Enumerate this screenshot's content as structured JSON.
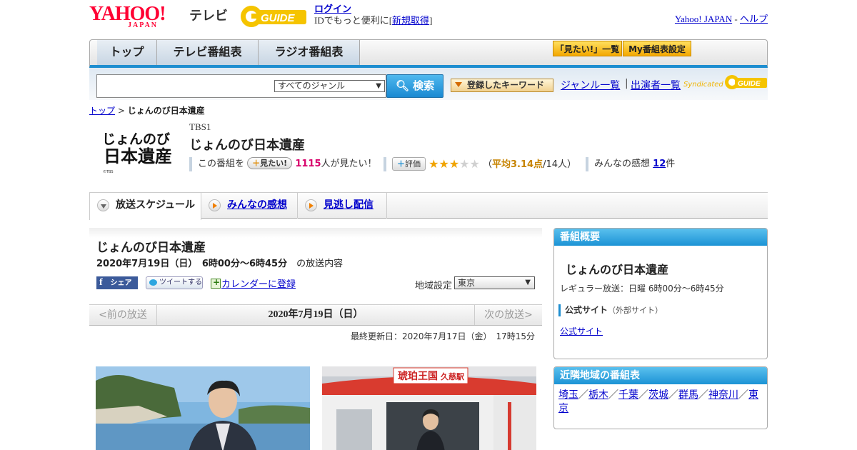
{
  "header": {
    "logo_text": "YAHOO!",
    "logo_sub": "JAPAN",
    "tv_label": "テレビ",
    "gguide_label": "G-GUIDE",
    "login": "ログイン",
    "login_prompt_pre": "IDでもっと便利に[",
    "signup": "新規取得",
    "login_prompt_post": "]",
    "yj_link": "Yahoo! JAPAN",
    "dash": "-",
    "help_link": "ヘルプ"
  },
  "nav": {
    "tabs": [
      "トップ",
      "テレビ番組表",
      "ラジオ番組表"
    ],
    "mitai_list": "「見たい!」一覧",
    "my_schedule": "My番組表設定"
  },
  "search": {
    "genre_selected": "すべてのジャンル",
    "search_button": "検索",
    "keyword_button": "登録したキーワード",
    "genre_list_link": "ジャンル一覧",
    "separator": "|",
    "performer_link": "出演者一覧",
    "syndicated": "Syndicated"
  },
  "breadcrumb": {
    "top": "トップ",
    "sep": ">",
    "current": "じょんのび日本遺産"
  },
  "program": {
    "logo_text": "じょんのび\n日本遺産",
    "logo_copy": "©TBS",
    "channel": "TBS1",
    "title": "じょんのび日本遺産",
    "mitai_prefix": "この番組を",
    "mitai_button": "見たい!",
    "mitai_count": "1115",
    "mitai_suffix": "人が見たい！",
    "rating_button": "評価",
    "stars_on": "★★★",
    "stars_off": "★★",
    "avg_open": "（",
    "avg_label": "平均3.14点",
    "avg_count": "/14人）",
    "comments_label": "みんなの感想",
    "comments_count": "12",
    "comments_unit": "件"
  },
  "subtabs": [
    "放送スケジュール",
    "みんなの感想",
    "見逃し配信"
  ],
  "main": {
    "title": "じょんのび日本遺産",
    "date": "2020年7月19日（日）　6時00分～6時45分",
    "date_suffix": "の放送内容",
    "share": "シェア",
    "tweet": "ツイートする",
    "calendar": "カレンダーに登録",
    "region_label": "地域設定",
    "region_value": "東京",
    "prev": "<前の放送",
    "current_day": "2020年7月19日（日）",
    "next": "次の放送>",
    "updated": "最終更新日：2020年7月17日（金）　17時15分",
    "photo2_sign": "琥珀王国",
    "photo2_station": "久慈駅"
  },
  "overview": {
    "header": "番組概要",
    "title": "じょんのび日本遺産",
    "regular": "レギュラー放送：日曜 6時00分～6時45分",
    "site_header": "公式サイト",
    "site_note": "（外部サイト）",
    "site_link": "公式サイト"
  },
  "nearby": {
    "header": "近隣地域の番組表",
    "regions": [
      "埼玉",
      "栃木",
      "千葉",
      "茨城",
      "群馬",
      "神奈川",
      "東京"
    ],
    "sep": "／"
  },
  "colors": {
    "accent_blue": "#1e8ed0",
    "yahoo_red": "#ff0033",
    "gguide_yellow": "#f5c400",
    "pink": "#d8006b"
  }
}
